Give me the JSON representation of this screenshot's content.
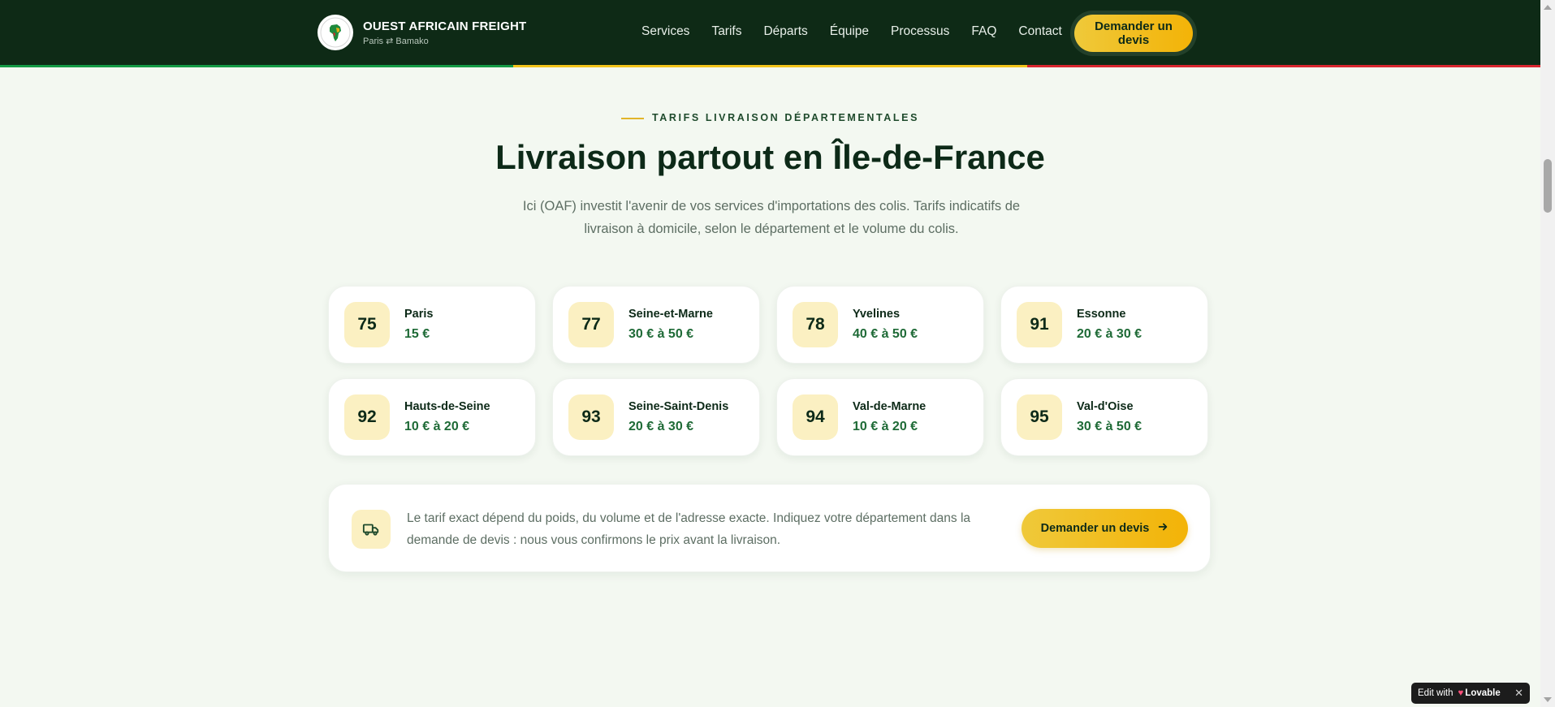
{
  "header": {
    "brand_name": "OUEST AFRICAIN FREIGHT",
    "brand_sub": "Paris ⇄ Bamako",
    "logo_icon": "africa-logo-icon",
    "nav": [
      "Services",
      "Tarifs",
      "Départs",
      "Équipe",
      "Processus",
      "FAQ",
      "Contact"
    ],
    "cta": "Demander un devis",
    "tricolor": [
      "#149a45",
      "#f2c41b",
      "#d8262f"
    ]
  },
  "section": {
    "eyebrow": "TARIFS LIVRAISON DÉPARTEMENTALES",
    "title": "Livraison partout en Île-de-France",
    "subtitle": "Ici (OAF) investit l'avenir de vos services d'importations des colis. Tarifs indicatifs de livraison à domicile, selon le département et le volume du colis."
  },
  "departments": [
    {
      "code": "75",
      "name": "Paris",
      "price": "15 €"
    },
    {
      "code": "77",
      "name": "Seine-et-Marne",
      "price": "30 € à 50 €"
    },
    {
      "code": "78",
      "name": "Yvelines",
      "price": "40 € à 50 €"
    },
    {
      "code": "91",
      "name": "Essonne",
      "price": "20 € à 30 €"
    },
    {
      "code": "92",
      "name": "Hauts-de-Seine",
      "price": "10 € à 20 €"
    },
    {
      "code": "93",
      "name": "Seine-Saint-Denis",
      "price": "20 € à 30 €"
    },
    {
      "code": "94",
      "name": "Val-de-Marne",
      "price": "10 € à 20 €"
    },
    {
      "code": "95",
      "name": "Val-d'Oise",
      "price": "30 € à 50 €"
    }
  ],
  "info": {
    "text": "Le tarif exact dépend du poids, du volume et de l'adresse exacte. Indiquez votre département dans la demande de devis : nous vous confirmons le prix avant la livraison.",
    "button": "Demander un devis",
    "icon": "truck-icon",
    "button_icon": "arrow-right-icon"
  },
  "lovable": {
    "edit_with": "Edit with",
    "brand": "Lovable",
    "close": "✕"
  },
  "colors": {
    "header_bg": "#0e2a16",
    "accent_yellow": "#f3b307",
    "price_green": "#1e6a36",
    "page_bg": "#f3f8f1"
  }
}
